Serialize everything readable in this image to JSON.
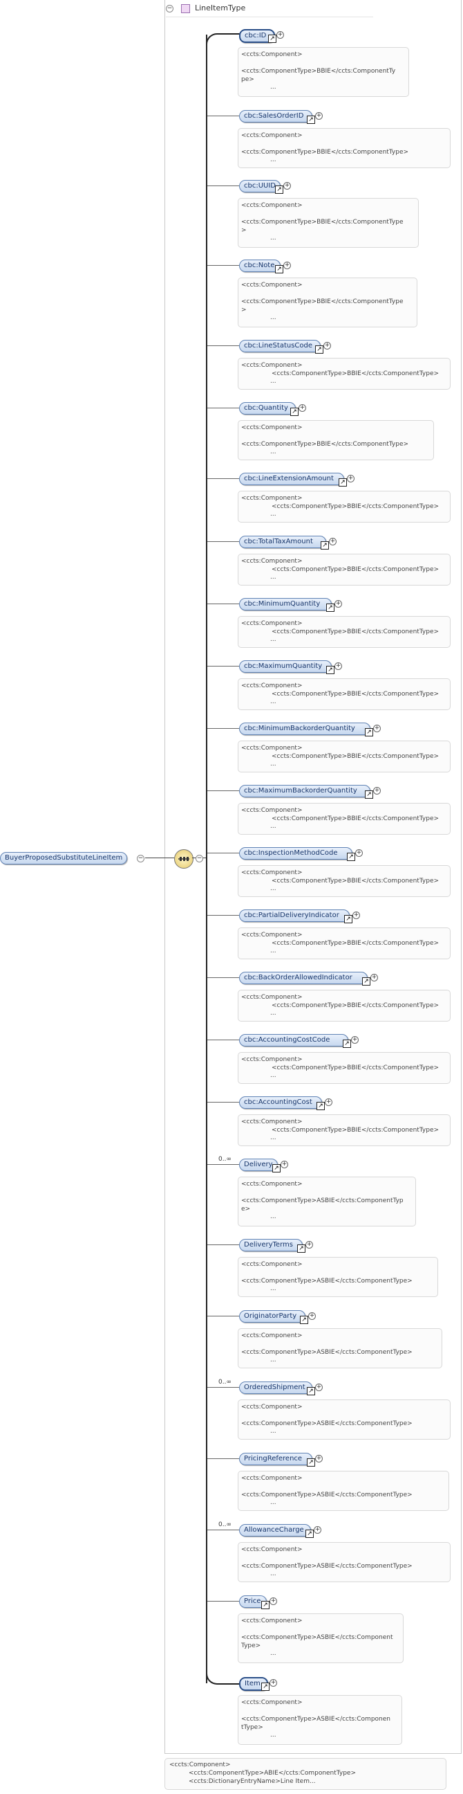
{
  "type_name": "LineItemType",
  "root_element": "BuyerProposedSubstituteLineItem",
  "icons": {
    "collapse": "minus-circle-icon",
    "expand": "plus-circle-icon",
    "reference": "reference-arrow-icon",
    "sequence": "sequence-compositor-icon"
  },
  "elements": [
    {
      "name": "cbc:ID",
      "occ": "",
      "card": [
        "<ccts:Component>",
        "",
        "<ccts:ComponentType>BBIE</ccts:ComponentTy",
        "pe>"
      ],
      "dots": "..."
    },
    {
      "name": "cbc:SalesOrderID",
      "occ": "",
      "card": [
        "<ccts:Component>",
        "",
        "<ccts:ComponentType>BBIE</ccts:ComponentType>"
      ],
      "dots": "..."
    },
    {
      "name": "cbc:UUID",
      "occ": "",
      "card": [
        "<ccts:Component>",
        "",
        "<ccts:ComponentType>BBIE</ccts:ComponentType",
        ">"
      ],
      "dots": "..."
    },
    {
      "name": "cbc:Note",
      "occ": "",
      "card": [
        "<ccts:Component>",
        "",
        "<ccts:ComponentType>BBIE</ccts:ComponentType",
        ">"
      ],
      "dots": "..."
    },
    {
      "name": "cbc:LineStatusCode",
      "occ": "",
      "card": [
        "<ccts:Component>",
        "<ccts:ComponentType>BBIE</ccts:ComponentType>"
      ],
      "dots": "..."
    },
    {
      "name": "cbc:Quantity",
      "occ": "",
      "card": [
        "<ccts:Component>",
        "",
        "<ccts:ComponentType>BBIE</ccts:ComponentType>"
      ],
      "dots": "..."
    },
    {
      "name": "cbc:LineExtensionAmount",
      "occ": "",
      "card": [
        "<ccts:Component>",
        "<ccts:ComponentType>BBIE</ccts:ComponentType>"
      ],
      "dots": "..."
    },
    {
      "name": "cbc:TotalTaxAmount",
      "occ": "",
      "card": [
        "<ccts:Component>",
        "<ccts:ComponentType>BBIE</ccts:ComponentType>"
      ],
      "dots": "..."
    },
    {
      "name": "cbc:MinimumQuantity",
      "occ": "",
      "card": [
        "<ccts:Component>",
        "<ccts:ComponentType>BBIE</ccts:ComponentType>"
      ],
      "dots": "..."
    },
    {
      "name": "cbc:MaximumQuantity",
      "occ": "",
      "card": [
        "<ccts:Component>",
        "<ccts:ComponentType>BBIE</ccts:ComponentType>"
      ],
      "dots": "..."
    },
    {
      "name": "cbc:MinimumBackorderQuantity",
      "occ": "",
      "card": [
        "<ccts:Component>",
        "<ccts:ComponentType>BBIE</ccts:ComponentType>"
      ],
      "dots": "..."
    },
    {
      "name": "cbc:MaximumBackorderQuantity",
      "occ": "",
      "card": [
        "<ccts:Component>",
        "<ccts:ComponentType>BBIE</ccts:ComponentType>"
      ],
      "dots": "..."
    },
    {
      "name": "cbc:InspectionMethodCode",
      "occ": "",
      "card": [
        "<ccts:Component>",
        "<ccts:ComponentType>BBIE</ccts:ComponentType>"
      ],
      "dots": "..."
    },
    {
      "name": "cbc:PartialDeliveryIndicator",
      "occ": "",
      "card": [
        "<ccts:Component>",
        "<ccts:ComponentType>BBIE</ccts:ComponentType>"
      ],
      "dots": "..."
    },
    {
      "name": "cbc:BackOrderAllowedIndicator",
      "occ": "",
      "card": [
        "<ccts:Component>",
        "<ccts:ComponentType>BBIE</ccts:ComponentType>"
      ],
      "dots": "..."
    },
    {
      "name": "cbc:AccountingCostCode",
      "occ": "",
      "card": [
        "<ccts:Component>",
        "<ccts:ComponentType>BBIE</ccts:ComponentType>"
      ],
      "dots": "..."
    },
    {
      "name": "cbc:AccountingCost",
      "occ": "",
      "card": [
        "<ccts:Component>",
        "<ccts:ComponentType>BBIE</ccts:ComponentType>"
      ],
      "dots": "..."
    },
    {
      "name": "Delivery",
      "occ": "0..∞",
      "card": [
        "<ccts:Component>",
        "",
        "<ccts:ComponentType>ASBIE</ccts:ComponentTyp",
        "e>"
      ],
      "dots": "..."
    },
    {
      "name": "DeliveryTerms",
      "occ": "",
      "card": [
        "<ccts:Component>",
        "",
        "<ccts:ComponentType>ASBIE</ccts:ComponentType>"
      ],
      "dots": "..."
    },
    {
      "name": "OriginatorParty",
      "occ": "",
      "card": [
        "<ccts:Component>",
        "",
        "<ccts:ComponentType>ASBIE</ccts:ComponentType>"
      ],
      "dots": "..."
    },
    {
      "name": "OrderedShipment",
      "occ": "0..∞",
      "card": [
        "<ccts:Component>",
        "",
        "<ccts:ComponentType>ASBIE</ccts:ComponentType>"
      ],
      "dots": "..."
    },
    {
      "name": "PricingReference",
      "occ": "",
      "card": [
        "<ccts:Component>",
        "",
        "<ccts:ComponentType>ASBIE</ccts:ComponentType>"
      ],
      "dots": "..."
    },
    {
      "name": "AllowanceCharge",
      "occ": "0..∞",
      "card": [
        "<ccts:Component>",
        "",
        "<ccts:ComponentType>ASBIE</ccts:ComponentType>"
      ],
      "dots": "..."
    },
    {
      "name": "Price",
      "occ": "",
      "card": [
        "<ccts:Component>",
        "",
        "<ccts:ComponentType>ASBIE</ccts:Component",
        "Type>"
      ],
      "dots": "..."
    },
    {
      "name": "Item",
      "occ": "",
      "card": [
        "<ccts:Component>",
        "",
        "<ccts:ComponentType>ASBIE</ccts:Componen",
        "tType>"
      ],
      "dots": "..."
    }
  ],
  "bottom_card": [
    "<ccts:Component>",
    "<ccts:ComponentType>ABIE</ccts:ComponentType>",
    "<ccts:DictionaryEntryName>Line Item..."
  ]
}
